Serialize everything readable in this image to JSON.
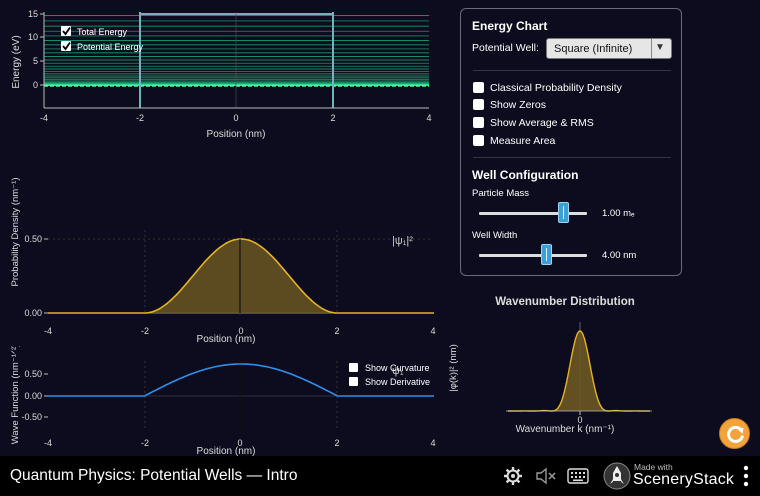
{
  "energy_chart": {
    "ylabel": "Energy (eV)",
    "xlabel": "Position (nm)",
    "yticks": [
      "15",
      "10",
      "5",
      "0"
    ],
    "xticks": [
      "-4",
      "-2",
      "0",
      "2",
      "4"
    ],
    "legend": {
      "total": "Total Energy",
      "potential": "Potential Energy",
      "total_checked": true,
      "potential_checked": true
    }
  },
  "probability_chart": {
    "ylabel": "Probability Density (nm⁻¹)",
    "xlabel": "Position (nm)",
    "yticks": [
      "0.50",
      "0.00"
    ],
    "xticks": [
      "-4",
      "-2",
      "0",
      "2",
      "4"
    ],
    "annotation": "|ψ₁|²"
  },
  "wave_chart": {
    "ylabel": "Wave Function (nm⁻¹ᐟ²)",
    "xlabel": "Position (nm)",
    "yticks": [
      "0.50",
      "0.00",
      "-0.50"
    ],
    "xticks": [
      "-4",
      "-2",
      "0",
      "2",
      "4"
    ],
    "annotation": "ψ₁",
    "show_curvature": "Show Curvature",
    "show_derivative": "Show Derivative"
  },
  "wavenumber_chart": {
    "title": "Wavenumber Distribution",
    "ylabel": "|φ(k)|² (nm)",
    "xlabel": "Wavenumber k (nm⁻¹)",
    "xtick": "0"
  },
  "control_panel": {
    "energy_title": "Energy Chart",
    "potential_well_label": "Potential Well:",
    "potential_well_value": "Square (Infinite)",
    "checkboxes": [
      {
        "label": "Classical Probability Density",
        "checked": false
      },
      {
        "label": "Show Zeros",
        "checked": false
      },
      {
        "label": "Show Average & RMS",
        "checked": false
      },
      {
        "label": "Measure Area",
        "checked": false
      }
    ],
    "well_title": "Well Configuration",
    "mass_label": "Particle Mass",
    "mass_value": "1.00 mₑ",
    "mass_fraction": 0.78,
    "width_label": "Well Width",
    "width_value": "4.00 nm",
    "width_fraction": 0.62
  },
  "footer": {
    "sim_title": "Quantum Physics: Potential Wells — Intro",
    "made_with": "Made with",
    "brand": "ScenerySt ack"
  },
  "colors": {
    "background": "#0c0c1e",
    "energy_levels": "#1fd38a",
    "probability": "#e6b422",
    "wave": "#2f8fe8",
    "well_walls": "#6fb3c0"
  }
}
